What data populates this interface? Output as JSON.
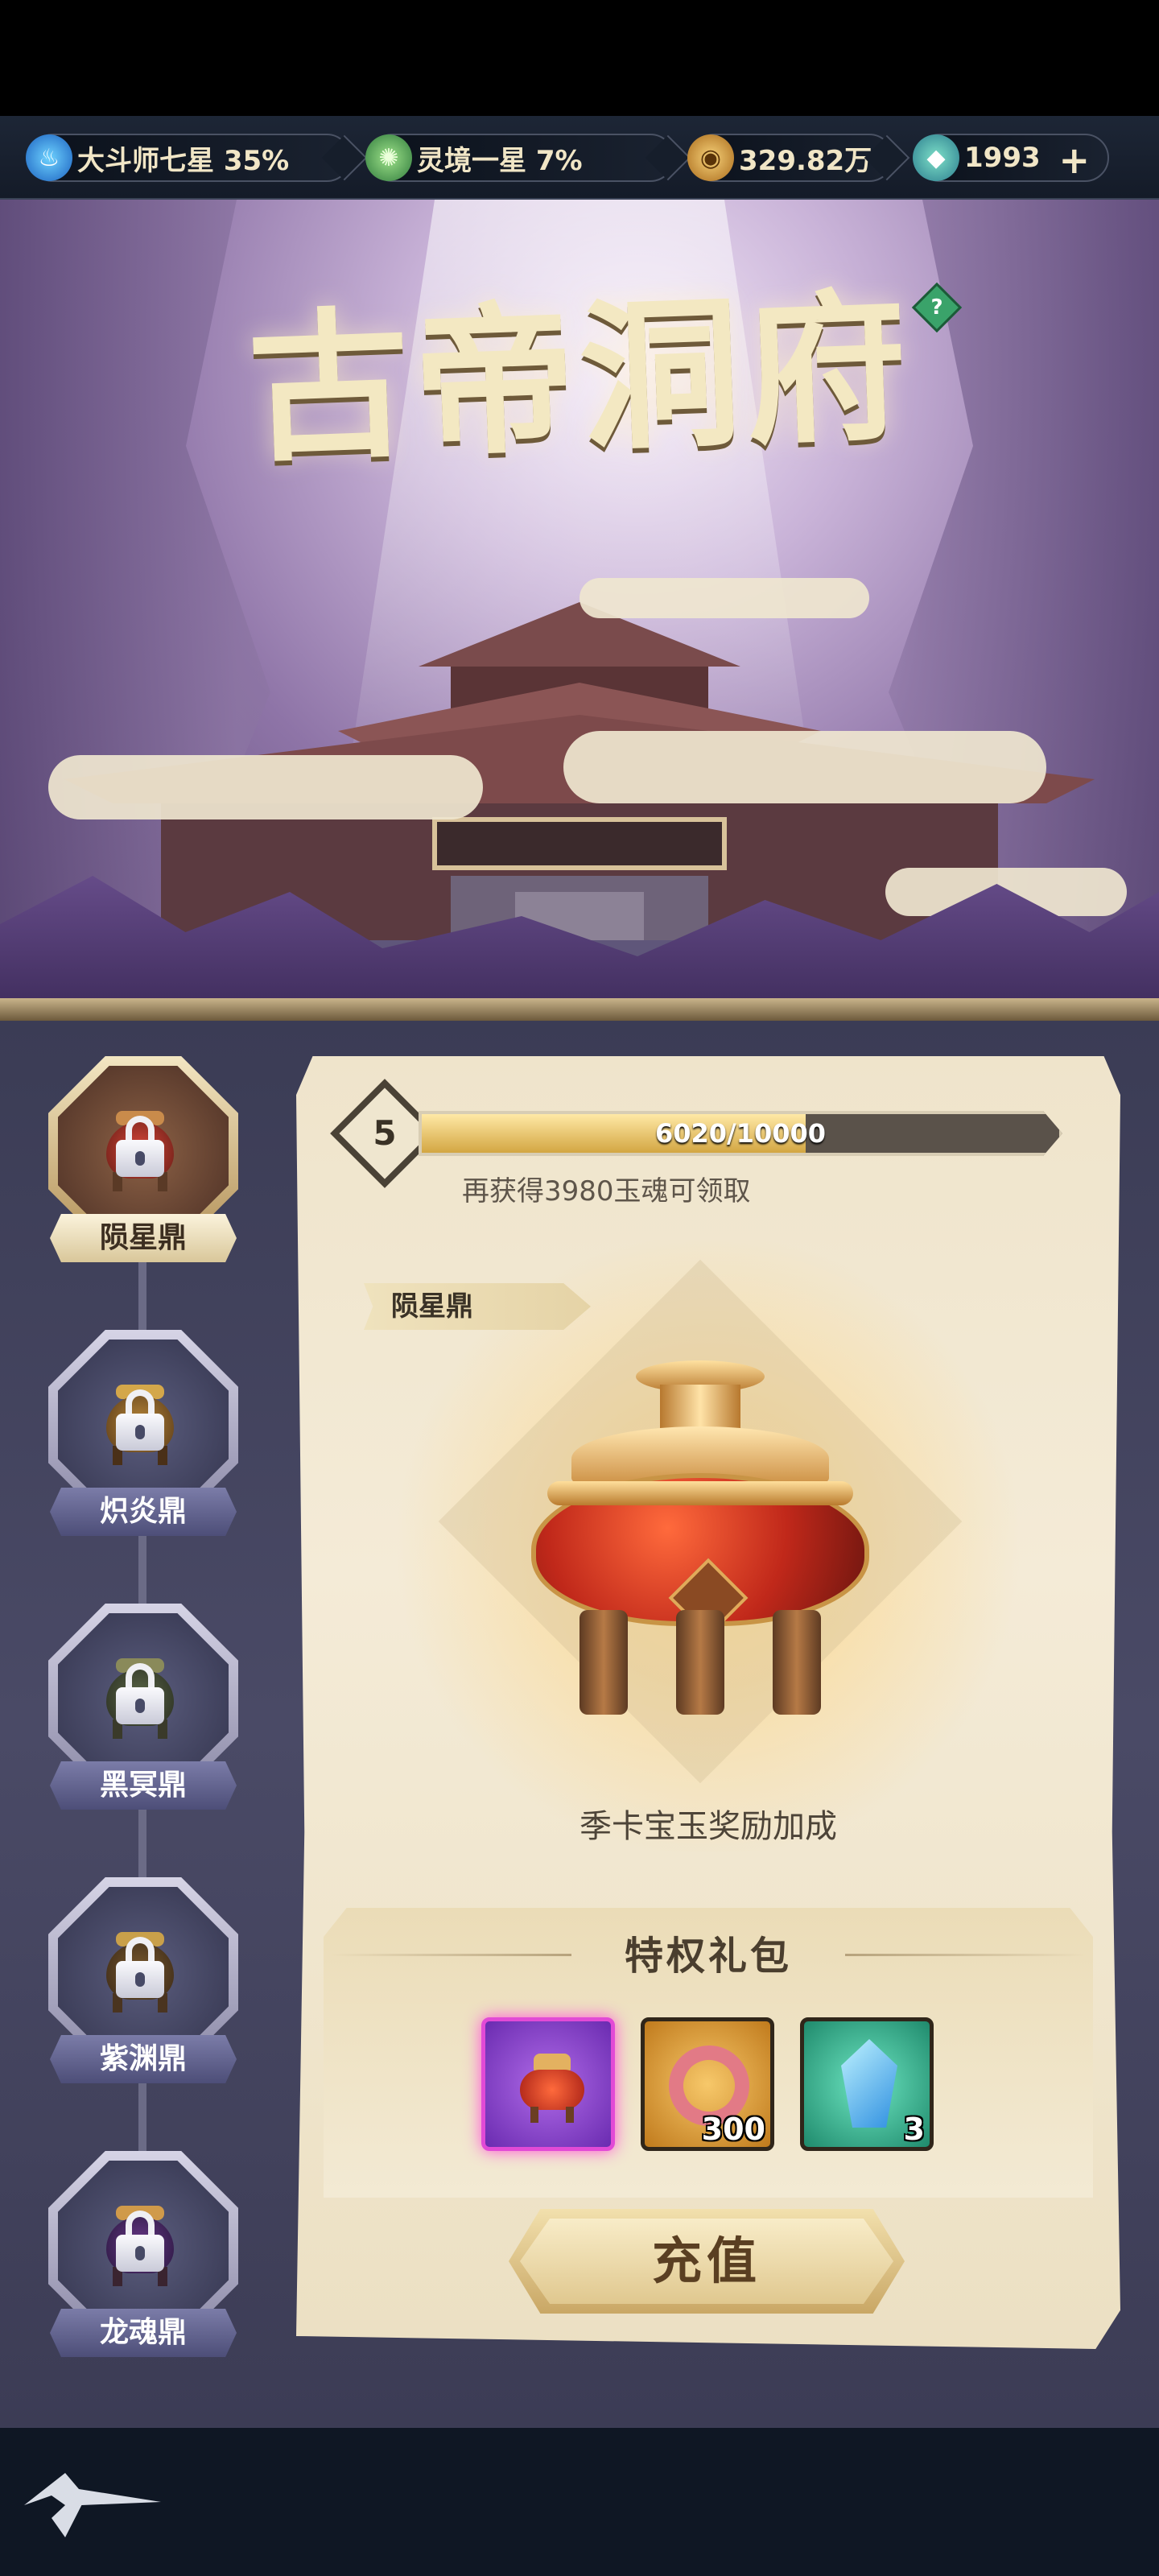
{
  "resources": {
    "rank": {
      "label": "大斗师七星 35%",
      "icon": "blue-flame-icon"
    },
    "realm": {
      "label": "灵境一星 7%",
      "icon": "green-swirl-icon"
    },
    "gold": {
      "label": "329.82万",
      "icon": "gold-coin-icon"
    },
    "jade": {
      "label": "1993",
      "icon": "jade-gem-icon",
      "add": "+"
    }
  },
  "banner": {
    "title": "古帝洞府",
    "help": "?"
  },
  "cauldrons": [
    {
      "label": "陨星鼎",
      "active": true,
      "locked": true
    },
    {
      "label": "炽炎鼎",
      "active": false,
      "locked": true
    },
    {
      "label": "黑冥鼎",
      "active": false,
      "locked": true
    },
    {
      "label": "紫渊鼎",
      "active": false,
      "locked": true
    },
    {
      "label": "龙魂鼎",
      "active": false,
      "locked": true
    }
  ],
  "detail": {
    "level": "5",
    "progress_text": "6020/10000",
    "progress_fraction": 0.602,
    "hint": "再获得3980玉魂可领取",
    "name_tag": "陨星鼎",
    "bonus_text": "季卡宝玉奖励加成"
  },
  "privilege": {
    "title": "特权礼包",
    "rewards": [
      {
        "icon": "cauldron-icon",
        "count": ""
      },
      {
        "icon": "pink-ring-icon",
        "count": "300"
      },
      {
        "icon": "blue-crystal-icon",
        "count": "3"
      }
    ]
  },
  "recharge_label": "充值",
  "colors": {
    "accent_gold": "#d3a642",
    "parchment": "#f4ebd7",
    "highlight_purple": "#e24ad6"
  }
}
